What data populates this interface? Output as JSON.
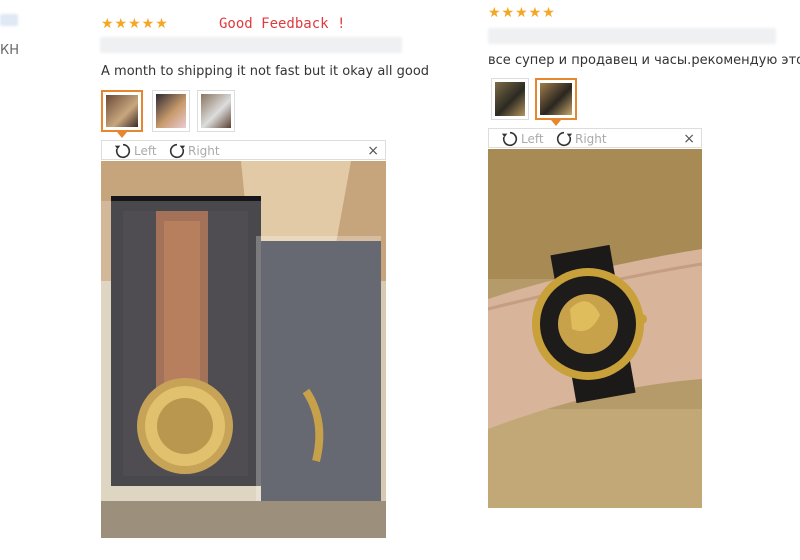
{
  "left_review": {
    "stars": "★★★★★",
    "tag": "Good Feedback !",
    "text": "A month to shipping it not fast but it okay all good",
    "viewer": {
      "left_label": "Left",
      "right_label": "Right",
      "close": "×"
    }
  },
  "right_review": {
    "stars": "★★★★★",
    "text": "все супер и продавец и часы.рекомендую этого пр",
    "viewer": {
      "left_label": "Left",
      "right_label": "Right",
      "close": "×"
    }
  },
  "edge_left": {
    "name_fragment": "КН"
  },
  "colors": {
    "star": "#f5a623",
    "accent": "#e6862f",
    "tag": "#e0393e"
  }
}
